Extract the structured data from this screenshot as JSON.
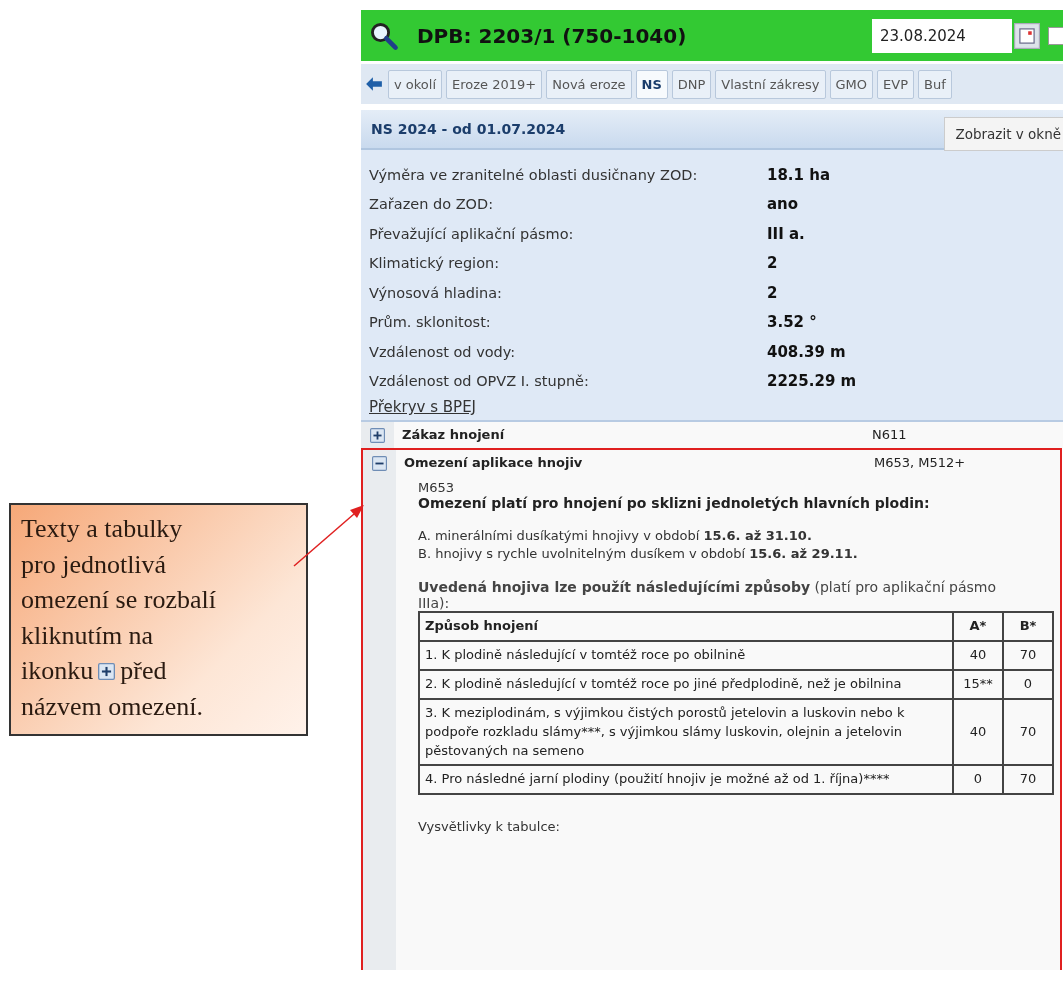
{
  "header": {
    "title": "DPB: 2203/1 (750-1040)",
    "date": "23.08.2024",
    "checkbox": {
      "checked": false
    }
  },
  "tabs": [
    {
      "label": "v okolí",
      "selected": false
    },
    {
      "label": "Eroze 2019+",
      "selected": false
    },
    {
      "label": "Nová eroze",
      "selected": false
    },
    {
      "label": "NS",
      "selected": true
    },
    {
      "label": "DNP",
      "selected": false
    },
    {
      "label": "Vlastní zákresy",
      "selected": false
    },
    {
      "label": "GMO",
      "selected": false
    },
    {
      "label": "EVP",
      "selected": false
    },
    {
      "label": "Buf",
      "selected": false
    }
  ],
  "section": {
    "title": "NS 2024 - od 01.07.2024",
    "button": "Zobrazit v okně"
  },
  "info": [
    {
      "label": "Výměra ve zranitelné oblasti dusičnany ZOD:",
      "value": "18.1 ha"
    },
    {
      "label": "Zařazen do ZOD:",
      "value": "ano"
    },
    {
      "label": "Převažující aplikační pásmo:",
      "value": "III a."
    },
    {
      "label": "Klimatický region:",
      "value": "2"
    },
    {
      "label": "Výnosová hladina:",
      "value": "2"
    },
    {
      "label": "Prům. sklonitost:",
      "value": "3.52 °"
    },
    {
      "label": "Vzdálenost od vody:",
      "value": "408.39 m"
    },
    {
      "label": "Vzdálenost od OPVZ I. stupně:",
      "value": "2225.29 m"
    }
  ],
  "link": "Překryv s BPEJ",
  "restrictions": [
    {
      "name": "Zákaz hnojení",
      "codes": "N611",
      "expanded": false,
      "highlighted": false
    },
    {
      "name": "Omezení aplikace hnojiv",
      "codes": "M653, M512+",
      "expanded": true,
      "highlighted": true,
      "body": {
        "code": "M653",
        "heading": "Omezení platí pro hnojení po sklizni jednoletých hlavních plodin:",
        "lines": [
          "A. minerálními dusíkatými hnojivy v období **15.6. až 31.10.**",
          "B. hnojivy s rychle uvolnitelným dusíkem v období **15.6. až 29.11.**"
        ],
        "intro": "**Uvedená hnojiva lze použít následujícími způsoby** (platí pro aplikační pásmo IIIa):",
        "table": {
          "columns": [
            "Způsob hnojení",
            "A*",
            "B*"
          ],
          "rows": [
            [
              "1. K plodině následující v tomtéž roce po obilnině",
              "40",
              "70"
            ],
            [
              "2. K plodině následující v tomtéž roce po jiné předplodině, než je obilnina",
              "15**",
              "0"
            ],
            [
              "3. K meziplodinám, s výjimkou čistých porostů jetelovin a luskovin nebo k podpoře rozkladu slámy***, s výjimkou slámy luskovin, olejnin a jetelovin pěstovaných na semeno",
              "40",
              "70"
            ],
            [
              "4. Pro následné jarní plodiny (použití hnojiv je možné až od 1. října)****",
              "0",
              "70"
            ]
          ]
        },
        "notes_title": "Vysvětlivky k tabulce:"
      }
    }
  ],
  "callout": {
    "lines_before": [
      "Texty a tabulky",
      "pro jednotlivá",
      "omezení se rozbalí",
      "kliknutím na"
    ],
    "icon_line": {
      "before": "ikonku",
      "after": "před"
    },
    "lines_after": [
      "názvem omezení."
    ]
  }
}
